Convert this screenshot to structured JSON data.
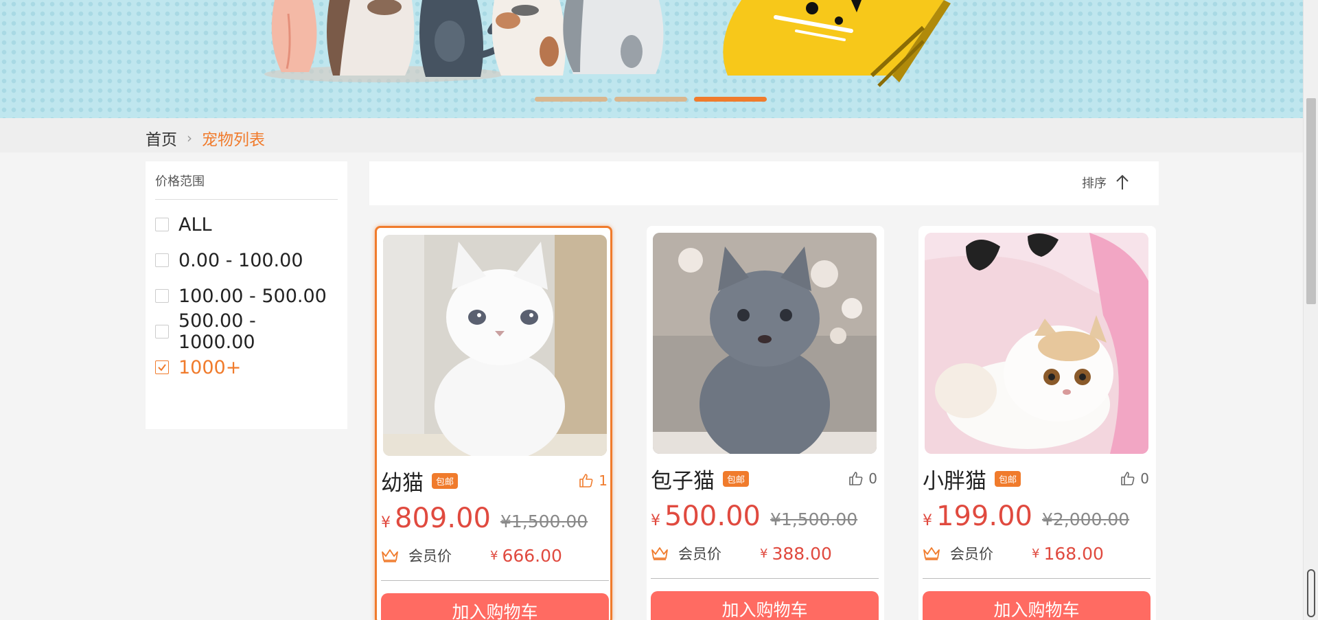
{
  "breadcrumb": {
    "home": "首页",
    "separator": "›",
    "current": "宠物列表"
  },
  "filter": {
    "title": "价格范围",
    "options": [
      {
        "label": "ALL",
        "checked": false
      },
      {
        "label": "0.00 - 100.00",
        "checked": false
      },
      {
        "label": "100.00 - 500.00",
        "checked": false
      },
      {
        "label": "500.00 - 1000.00",
        "checked": false
      },
      {
        "label": "1000+",
        "checked": true
      }
    ]
  },
  "sort": {
    "label": "排序",
    "icon": "arrow-up-icon"
  },
  "banner": {
    "slides_total": 3,
    "active_slide": 3
  },
  "products": [
    {
      "name": "幼猫",
      "badge": "包邮",
      "likes": "1",
      "liked": true,
      "currency": "¥",
      "price": "809.00",
      "original_price": "¥1,500.00",
      "member_label": "会员价",
      "member_currency": "¥",
      "member_price": "666.00",
      "cart_label": "加入购物车",
      "image": "white kitten"
    },
    {
      "name": "包子猫",
      "badge": "包邮",
      "likes": "0",
      "liked": false,
      "currency": "¥",
      "price": "500.00",
      "original_price": "¥1,500.00",
      "member_label": "会员价",
      "member_currency": "¥",
      "member_price": "388.00",
      "cart_label": "加入购物车",
      "image": "gray kitten"
    },
    {
      "name": "小胖猫",
      "badge": "包邮",
      "likes": "0",
      "liked": false,
      "currency": "¥",
      "price": "199.00",
      "original_price": "¥2,000.00",
      "member_label": "会员价",
      "member_currency": "¥",
      "member_price": "168.00",
      "cart_label": "加入购物车",
      "image": "exotic shorthair kitten"
    }
  ],
  "colors": {
    "accent": "#f07b2c",
    "price": "#e04a3f",
    "cart_button": "#ff6b62"
  }
}
